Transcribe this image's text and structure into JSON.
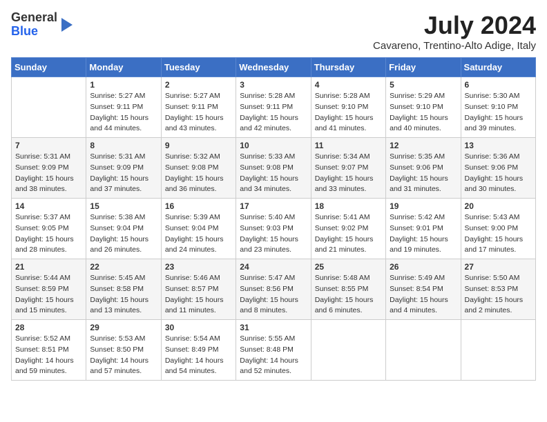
{
  "header": {
    "logo_line1": "General",
    "logo_line2": "Blue",
    "month_title": "July 2024",
    "location": "Cavareno, Trentino-Alto Adige, Italy"
  },
  "weekdays": [
    "Sunday",
    "Monday",
    "Tuesday",
    "Wednesday",
    "Thursday",
    "Friday",
    "Saturday"
  ],
  "weeks": [
    [
      {
        "day": "",
        "info": ""
      },
      {
        "day": "1",
        "info": "Sunrise: 5:27 AM\nSunset: 9:11 PM\nDaylight: 15 hours\nand 44 minutes."
      },
      {
        "day": "2",
        "info": "Sunrise: 5:27 AM\nSunset: 9:11 PM\nDaylight: 15 hours\nand 43 minutes."
      },
      {
        "day": "3",
        "info": "Sunrise: 5:28 AM\nSunset: 9:11 PM\nDaylight: 15 hours\nand 42 minutes."
      },
      {
        "day": "4",
        "info": "Sunrise: 5:28 AM\nSunset: 9:10 PM\nDaylight: 15 hours\nand 41 minutes."
      },
      {
        "day": "5",
        "info": "Sunrise: 5:29 AM\nSunset: 9:10 PM\nDaylight: 15 hours\nand 40 minutes."
      },
      {
        "day": "6",
        "info": "Sunrise: 5:30 AM\nSunset: 9:10 PM\nDaylight: 15 hours\nand 39 minutes."
      }
    ],
    [
      {
        "day": "7",
        "info": "Sunrise: 5:31 AM\nSunset: 9:09 PM\nDaylight: 15 hours\nand 38 minutes."
      },
      {
        "day": "8",
        "info": "Sunrise: 5:31 AM\nSunset: 9:09 PM\nDaylight: 15 hours\nand 37 minutes."
      },
      {
        "day": "9",
        "info": "Sunrise: 5:32 AM\nSunset: 9:08 PM\nDaylight: 15 hours\nand 36 minutes."
      },
      {
        "day": "10",
        "info": "Sunrise: 5:33 AM\nSunset: 9:08 PM\nDaylight: 15 hours\nand 34 minutes."
      },
      {
        "day": "11",
        "info": "Sunrise: 5:34 AM\nSunset: 9:07 PM\nDaylight: 15 hours\nand 33 minutes."
      },
      {
        "day": "12",
        "info": "Sunrise: 5:35 AM\nSunset: 9:06 PM\nDaylight: 15 hours\nand 31 minutes."
      },
      {
        "day": "13",
        "info": "Sunrise: 5:36 AM\nSunset: 9:06 PM\nDaylight: 15 hours\nand 30 minutes."
      }
    ],
    [
      {
        "day": "14",
        "info": "Sunrise: 5:37 AM\nSunset: 9:05 PM\nDaylight: 15 hours\nand 28 minutes."
      },
      {
        "day": "15",
        "info": "Sunrise: 5:38 AM\nSunset: 9:04 PM\nDaylight: 15 hours\nand 26 minutes."
      },
      {
        "day": "16",
        "info": "Sunrise: 5:39 AM\nSunset: 9:04 PM\nDaylight: 15 hours\nand 24 minutes."
      },
      {
        "day": "17",
        "info": "Sunrise: 5:40 AM\nSunset: 9:03 PM\nDaylight: 15 hours\nand 23 minutes."
      },
      {
        "day": "18",
        "info": "Sunrise: 5:41 AM\nSunset: 9:02 PM\nDaylight: 15 hours\nand 21 minutes."
      },
      {
        "day": "19",
        "info": "Sunrise: 5:42 AM\nSunset: 9:01 PM\nDaylight: 15 hours\nand 19 minutes."
      },
      {
        "day": "20",
        "info": "Sunrise: 5:43 AM\nSunset: 9:00 PM\nDaylight: 15 hours\nand 17 minutes."
      }
    ],
    [
      {
        "day": "21",
        "info": "Sunrise: 5:44 AM\nSunset: 8:59 PM\nDaylight: 15 hours\nand 15 minutes."
      },
      {
        "day": "22",
        "info": "Sunrise: 5:45 AM\nSunset: 8:58 PM\nDaylight: 15 hours\nand 13 minutes."
      },
      {
        "day": "23",
        "info": "Sunrise: 5:46 AM\nSunset: 8:57 PM\nDaylight: 15 hours\nand 11 minutes."
      },
      {
        "day": "24",
        "info": "Sunrise: 5:47 AM\nSunset: 8:56 PM\nDaylight: 15 hours\nand 8 minutes."
      },
      {
        "day": "25",
        "info": "Sunrise: 5:48 AM\nSunset: 8:55 PM\nDaylight: 15 hours\nand 6 minutes."
      },
      {
        "day": "26",
        "info": "Sunrise: 5:49 AM\nSunset: 8:54 PM\nDaylight: 15 hours\nand 4 minutes."
      },
      {
        "day": "27",
        "info": "Sunrise: 5:50 AM\nSunset: 8:53 PM\nDaylight: 15 hours\nand 2 minutes."
      }
    ],
    [
      {
        "day": "28",
        "info": "Sunrise: 5:52 AM\nSunset: 8:51 PM\nDaylight: 14 hours\nand 59 minutes."
      },
      {
        "day": "29",
        "info": "Sunrise: 5:53 AM\nSunset: 8:50 PM\nDaylight: 14 hours\nand 57 minutes."
      },
      {
        "day": "30",
        "info": "Sunrise: 5:54 AM\nSunset: 8:49 PM\nDaylight: 14 hours\nand 54 minutes."
      },
      {
        "day": "31",
        "info": "Sunrise: 5:55 AM\nSunset: 8:48 PM\nDaylight: 14 hours\nand 52 minutes."
      },
      {
        "day": "",
        "info": ""
      },
      {
        "day": "",
        "info": ""
      },
      {
        "day": "",
        "info": ""
      }
    ]
  ]
}
